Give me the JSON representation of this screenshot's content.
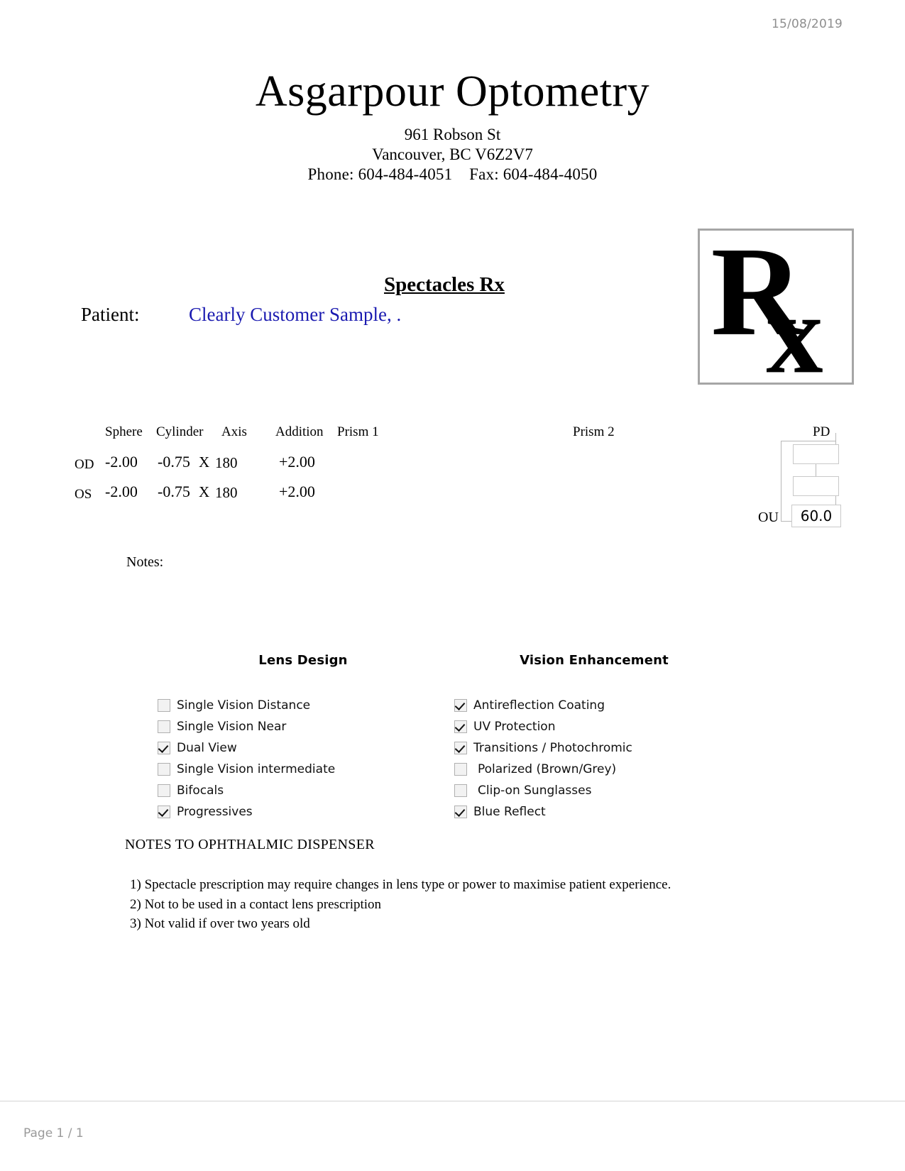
{
  "document": {
    "date": "15/08/2019",
    "footer_page": "Page 1 / 1"
  },
  "clinic": {
    "name": "Asgarpour Optometry",
    "address_line1": "961 Robson St",
    "address_line2": "Vancouver, BC V6Z2V7",
    "contact_line": "Phone: 604-484-4051    Fax: 604-484-4050"
  },
  "logo": {
    "name": "rx-symbol",
    "text": "Rx"
  },
  "title": "Spectacles Rx",
  "patient": {
    "label": "Patient:",
    "name": "Clearly Customer Sample, ."
  },
  "prescription": {
    "headers": {
      "sphere": "Sphere",
      "cylinder": "Cylinder",
      "axis": "Axis",
      "addition": "Addition",
      "prism1": "Prism 1",
      "prism2": "Prism 2"
    },
    "axis_separator": "X",
    "rows": [
      {
        "eye": "OD",
        "sphere": "-2.00",
        "cylinder": "-0.75",
        "axis": "180",
        "addition": "+2.00",
        "prism1": "",
        "prism2": ""
      },
      {
        "eye": "OS",
        "sphere": "-2.00",
        "cylinder": "-0.75",
        "axis": "180",
        "addition": "+2.00",
        "prism1": "",
        "prism2": ""
      }
    ]
  },
  "pd": {
    "label": "PD",
    "od_value": "",
    "os_value": "",
    "ou_label": "OU",
    "ou_value": "60.0"
  },
  "notes": {
    "label": "Notes:",
    "value": ""
  },
  "lens_design": {
    "heading": "Lens Design",
    "options": [
      {
        "label": "Single Vision Distance",
        "checked": false
      },
      {
        "label": "Single Vision Near",
        "checked": false
      },
      {
        "label": "Dual View",
        "checked": true
      },
      {
        "label": "Single Vision intermediate",
        "checked": false
      },
      {
        "label": "Bifocals",
        "checked": false
      },
      {
        "label": "Progressives",
        "checked": true
      }
    ]
  },
  "vision_enhancement": {
    "heading": "Vision Enhancement",
    "options": [
      {
        "label": "Antireflection Coating",
        "checked": true
      },
      {
        "label": "UV Protection",
        "checked": true
      },
      {
        "label": "Transitions / Photochromic",
        "checked": true
      },
      {
        "label": "Polarized (Brown/Grey)",
        "checked": false
      },
      {
        "label": "Clip-on Sunglasses",
        "checked": false
      },
      {
        "label": "Blue Reflect",
        "checked": true
      }
    ]
  },
  "dispenser_notes": {
    "title": "NOTES TO OPHTHALMIC DISPENSER",
    "items": [
      "1) Spectacle prescription may require changes in lens type or power to maximise patient experience.",
      "2) Not to be used in a contact lens prescription",
      "3) Not valid if over two years old"
    ]
  }
}
